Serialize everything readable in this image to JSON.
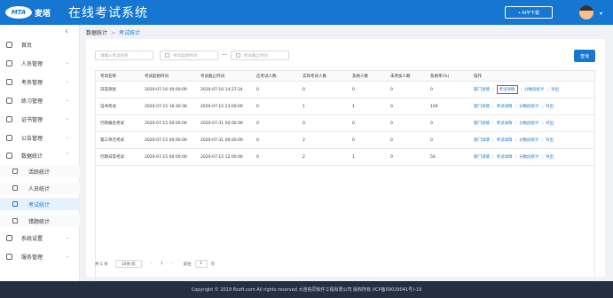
{
  "header": {
    "logo_badge": "MTA",
    "logo_text": "麦塔",
    "title": "在线考试系统",
    "app_button": "• APP下载",
    "accent": "#1677d2"
  },
  "sidebar": {
    "collapse_icon": "‹",
    "items": [
      {
        "label": "首页",
        "icon": "home-icon",
        "chevron": ""
      },
      {
        "label": "人员管理",
        "icon": "user-icon",
        "chevron": "⌄"
      },
      {
        "label": "考务管理",
        "icon": "exam-icon",
        "chevron": "⌄"
      },
      {
        "label": "练习管理",
        "icon": "practice-icon",
        "chevron": "⌄"
      },
      {
        "label": "证书管理",
        "icon": "certificate-icon",
        "chevron": "⌄"
      },
      {
        "label": "公告管理",
        "icon": "notice-icon",
        "chevron": "⌄"
      },
      {
        "label": "数据统计",
        "icon": "stats-icon",
        "chevron": "⌃"
      },
      {
        "label": "系统设置",
        "icon": "settings-icon",
        "chevron": "⌄"
      },
      {
        "label": "服务管理",
        "icon": "service-icon",
        "chevron": "⌄"
      }
    ],
    "sub_items": [
      {
        "label": "活跃统计",
        "icon": "activity-icon"
      },
      {
        "label": "人员统计",
        "icon": "person-icon"
      },
      {
        "label": "考试统计",
        "icon": "exam-stats-icon"
      },
      {
        "label": "错题统计",
        "icon": "mistakes-icon"
      }
    ]
  },
  "breadcrumb": {
    "parent": "数据统计",
    "separator": ">",
    "current": "考试统计"
  },
  "filters": {
    "exam_name_placeholder": "请输入考试名称",
    "start_time_placeholder": "考试起始时间",
    "end_time_placeholder": "考试截止时间",
    "dash": "—",
    "query_button": "查询"
  },
  "table": {
    "headers": [
      "考试名称",
      "考试起始时间",
      "考试截止时间",
      "应考试人数",
      "实际考试人数",
      "及格人数",
      "未参加人数",
      "及格率(%)",
      "操作"
    ],
    "rows": [
      {
        "cells": [
          "日常测试",
          "2020-07-16 00:00:00",
          "2020-07-16 14:27:24",
          "0",
          "0",
          "0",
          "0",
          "0"
        ]
      },
      {
        "cells": [
          "证书考试",
          "2020-07-15 16:30:36",
          "2020-07-15 23:00:00",
          "0",
          "1",
          "1",
          "0",
          "100"
        ]
      },
      {
        "cells": [
          "行政报名考试",
          "2020-07-15 00:00:00",
          "2020-07-31 00:00:00",
          "0",
          "0",
          "0",
          "0",
          "0"
        ]
      },
      {
        "cells": [
          "第三单元考试",
          "2020-07-15 00:00:00",
          "2020-07-31 00:00:00",
          "0",
          "2",
          "0",
          "0",
          "0"
        ]
      },
      {
        "cells": [
          "行政日常考试",
          "2020-07-15 00:00:00",
          "2020-07-15 12:00:00",
          "0",
          "2",
          "1",
          "0",
          "50"
        ]
      }
    ],
    "ops": [
      "部门详情",
      "考试详情",
      "分数段统计",
      "导出"
    ],
    "op_separator": "|"
  },
  "pagination": {
    "total": "共 5 条",
    "page_size": "10条/页",
    "prev": "‹",
    "current_page": "1",
    "next": "›",
    "goto_label": "前往",
    "goto_value": "1",
    "page_suffix": "页"
  },
  "footer": {
    "text": "Copyright © 2019 Rsoft.com All rights reserved 大连铭同软件工程有限公司 版权所有 (ICP备09029041号)-19"
  },
  "colors": {
    "header_bg": "#1677d2",
    "link": "#1677d2",
    "highlight_border": "#e53935",
    "footer_bg": "#243042"
  }
}
